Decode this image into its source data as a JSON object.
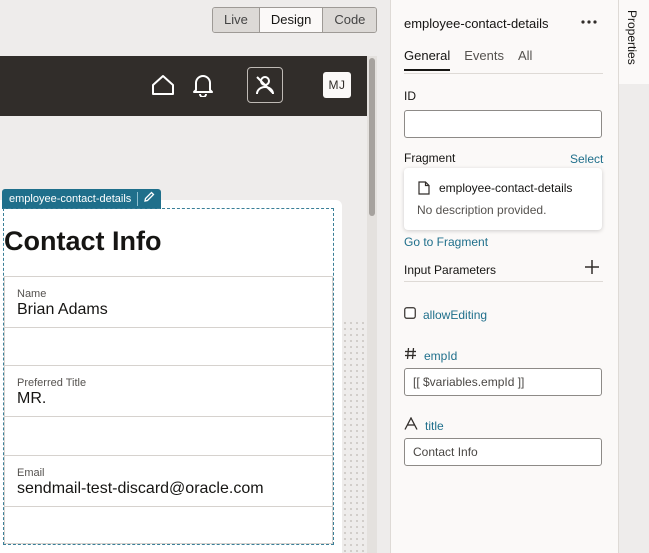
{
  "canvas": {
    "modes": [
      "Live",
      "Design",
      "Code"
    ],
    "active_mode": "Design",
    "header": {
      "avatar_initials": "MJ"
    },
    "fragment_tag": "employee-contact-details",
    "page": {
      "title": "Contact Info",
      "fields": [
        {
          "label": "Name",
          "value": "Brian Adams"
        },
        {
          "label": "Preferred Title",
          "value": "MR."
        },
        {
          "label": "Email",
          "value": "sendmail-test-discard@oracle.com"
        }
      ]
    }
  },
  "properties": {
    "title": "employee-contact-details",
    "tabs": [
      "General",
      "Events",
      "All"
    ],
    "active_tab": "General",
    "id_label": "ID",
    "id_value": "",
    "fragment_label": "Fragment",
    "select_link": "Select",
    "fragment_card": {
      "name": "employee-contact-details",
      "description": "No description provided."
    },
    "go_to_fragment": "Go to Fragment",
    "input_parameters_label": "Input Parameters",
    "params": {
      "allow_editing": {
        "name": "allowEditing",
        "checked": false
      },
      "emp_id": {
        "name": "empId",
        "value": "[[ $variables.empId ]]"
      },
      "title": {
        "name": "title",
        "value": "Contact Info"
      }
    }
  },
  "side_strip": {
    "label": "Properties"
  }
}
